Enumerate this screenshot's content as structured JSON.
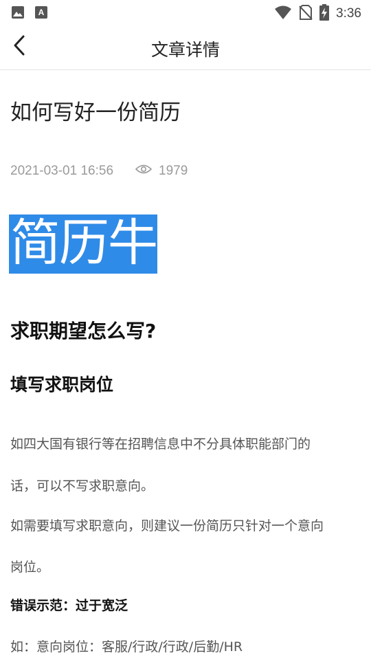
{
  "status_bar": {
    "time": "3:36",
    "icons": [
      "image-icon",
      "text-a-icon",
      "wifi-icon",
      "no-sim-icon",
      "battery-charging-icon"
    ]
  },
  "app_bar": {
    "title": "文章详情",
    "back_icon": "chevron-left-icon"
  },
  "article": {
    "title": "如何写好一份简历",
    "date": "2021-03-01 16:56",
    "views_icon": "eye-icon",
    "views": "1979",
    "hero_text": "简历牛",
    "hero_color": "#2f8be8",
    "heading1": "求职期望怎么写?",
    "heading2": "填写求职岗位",
    "paragraph_lines": [
      "如四大国有银行等在招聘信息中不分具体职能部门的",
      "话，可以不写求职意向。",
      "如需要填写求职意向，则建议一份简历只针对一个意向",
      "岗位。"
    ],
    "bold_line": "错误示范：过于宽泛",
    "example_line": "如：意向岗位：客服/行政/行政/后勤/HR"
  }
}
